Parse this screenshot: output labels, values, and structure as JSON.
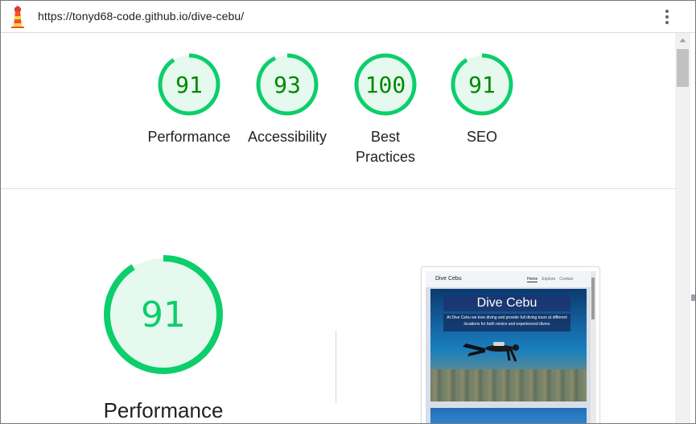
{
  "browser": {
    "url": "https://tonyd68-code.github.io/dive-cebu/",
    "menu_icon": "kebab-menu-icon",
    "logo_icon": "lighthouse-icon"
  },
  "scores": [
    {
      "value": "91",
      "label": "Performance",
      "score": 0.91
    },
    {
      "value": "93",
      "label": "Accessibility",
      "score": 0.93
    },
    {
      "value": "100",
      "label": "Best Practices",
      "score": 1.0
    },
    {
      "value": "91",
      "label": "SEO",
      "score": 0.91
    }
  ],
  "performance": {
    "value": "91",
    "label": "Performance",
    "score": 0.91
  },
  "screenshot": {
    "brand": "Dive Cebu",
    "nav": [
      "Home",
      "Explore",
      "Contact"
    ],
    "hero_title": "Dive Cebu",
    "hero_text": "At Dive Cebu we love diving and provide full diving tours at different locations for both novice and experienced divers"
  },
  "colors": {
    "pass": "#0cce6b",
    "pass_text": "#008800",
    "pass_fill": "#e6f9ee"
  }
}
